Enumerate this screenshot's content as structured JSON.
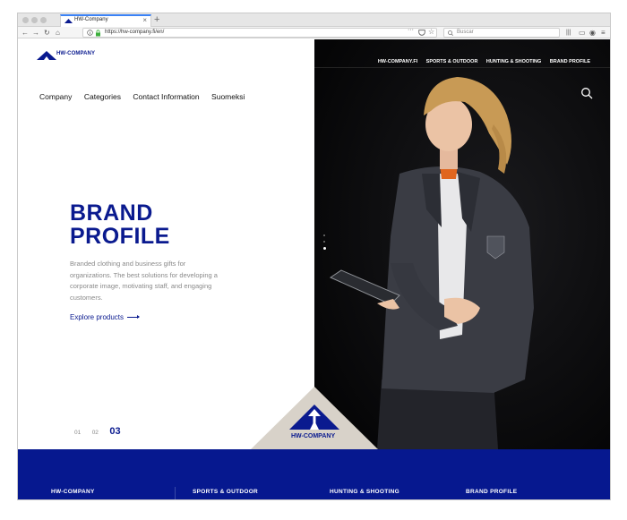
{
  "browser": {
    "tab_title": "HW-Company",
    "tab_close": "×",
    "new_tab": "+",
    "url": "https://hw-company.fi/en/",
    "search_placeholder": "Buscar"
  },
  "site": {
    "logo_text": "HW-COMPANY",
    "top_nav": [
      "HW-COMPANY.FI",
      "SPORTS & OUTDOOR",
      "HUNTING & SHOOTING",
      "BRAND PROFILE"
    ],
    "main_nav": [
      "Company",
      "Categories",
      "Contact Information",
      "Suomeksi"
    ]
  },
  "hero": {
    "headline_line1": "BRAND",
    "headline_line2": "PROFILE",
    "description": "Branded clothing and business gifts for organizations. The best solutions for developing a corporate image, motivating staff, and engaging customers.",
    "cta": "Explore products",
    "slides": [
      "01",
      "02",
      "03"
    ],
    "active_slide": "03"
  },
  "badge": {
    "text": "HW-COMPANY"
  },
  "footer": {
    "items": [
      "HW-COMPANY",
      "SPORTS & OUTDOOR",
      "HUNTING & SHOOTING",
      "BRAND PROFILE"
    ]
  },
  "colors": {
    "brand_blue": "#0a1a8f",
    "footer_blue": "#06188f",
    "badge_beige": "#d8d2c9"
  }
}
